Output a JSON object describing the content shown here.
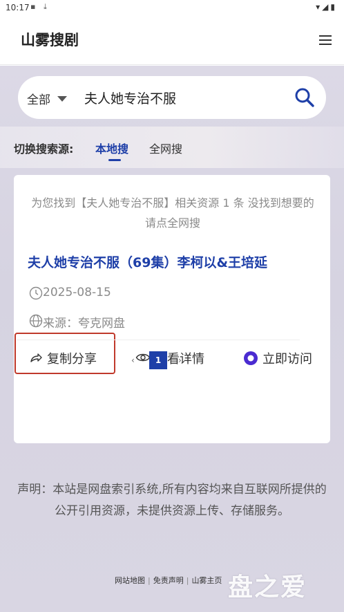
{
  "status_bar": {
    "time": "10:17"
  },
  "header": {
    "site_title": "山雾搜剧"
  },
  "search": {
    "scope": "全部",
    "query": "夫人她专治不服"
  },
  "source_switch": {
    "label": "切换搜索源:",
    "tabs": [
      "本地搜",
      "全网搜"
    ],
    "active": "本地搜"
  },
  "result": {
    "info": "为您找到【夫人她专治不服】相关资源 1 条 没找到想要的请点全网搜",
    "title": "夫人她专治不服（69集）李柯以&王培延",
    "date": "2025-08-15",
    "source": "来源：夸克网盘",
    "actions": {
      "copy": "复制分享",
      "detail": "查看详情",
      "visit": "立即访问"
    }
  },
  "pagination": {
    "prev": "‹",
    "current": "1",
    "next": "›"
  },
  "disclaimer": "声明：本站是网盘索引系统,所有内容均来自互联网所提供的公开引用资源，未提供资源上传、存储服务。",
  "footer": {
    "links": [
      "网站地图",
      "免责声明",
      "山雾主页"
    ]
  },
  "watermark": "盘之爱",
  "colors": {
    "accent": "#1e3fa8",
    "highlight": "#c0392b"
  }
}
